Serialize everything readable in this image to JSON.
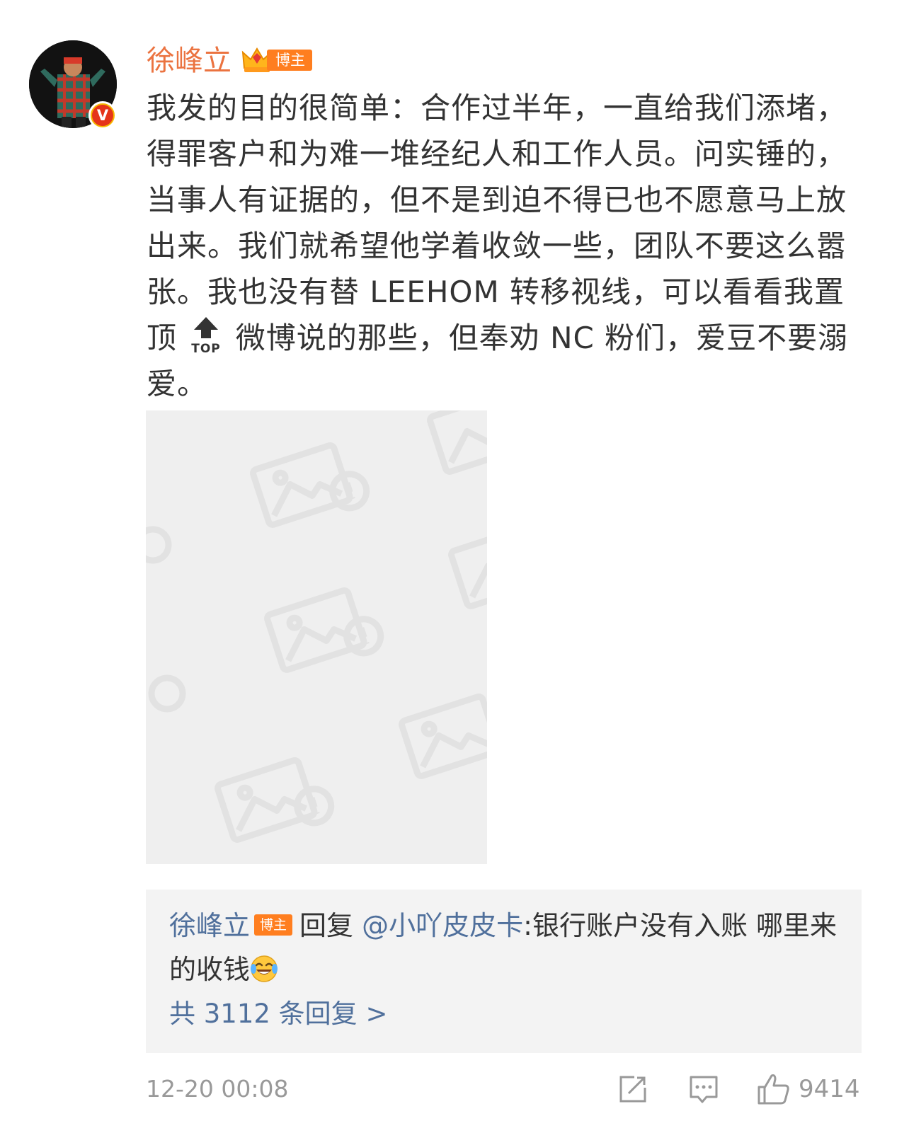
{
  "post": {
    "username": "徐峰立",
    "blogger_tag": "博主",
    "verified_badge": "V",
    "text_part1": "我发的目的很简单：合作过半年，一直给我们添堵，得罪客户和为难一堆经纪人和工作人员。问实锤的，当事人有证据的，但不是到迫不得已也不愿意马上放出来。我们就希望他学着收敛一些，团队不要这么嚣张。我也没有替 LEEHOM 转移视线，可以看看我置顶",
    "top_icon_label": "TOP",
    "text_part2": "微博说的那些，但奉劝 NC 粉们，爱豆不要溺爱。"
  },
  "reply": {
    "user": "徐峰立",
    "tag": "博主",
    "reply_word": "回复",
    "mention": "@小吖皮皮卡",
    "text": ":银行账户没有入账 哪里来的收钱",
    "emoji": "laugh-cry-emoji",
    "count_label": "共 3112 条回复 >"
  },
  "footer": {
    "timestamp": "12-20 00:08",
    "like_count": "9414"
  },
  "icons": [
    "repost-icon",
    "comment-icon",
    "like-icon"
  ],
  "colors": {
    "username": "#eb7340",
    "badge": "#ff7e1f",
    "link": "#50709c",
    "muted": "#999999"
  }
}
